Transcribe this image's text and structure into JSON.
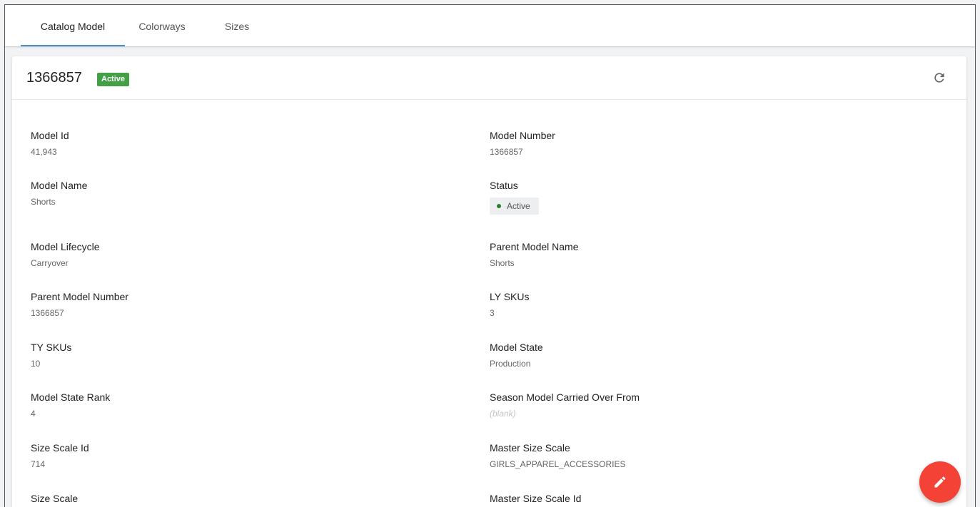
{
  "tabs": [
    {
      "label": "Catalog Model",
      "active": true
    },
    {
      "label": "Colorways",
      "active": false
    },
    {
      "label": "Sizes",
      "active": false
    }
  ],
  "header": {
    "title": "1366857",
    "badge": "Active",
    "refresh_icon": "refresh-icon"
  },
  "fields": {
    "model_id": {
      "label": "Model Id",
      "value": "41,943"
    },
    "model_number": {
      "label": "Model Number",
      "value": "1366857"
    },
    "model_name": {
      "label": "Model Name",
      "value": "Shorts"
    },
    "status": {
      "label": "Status",
      "value": "Active"
    },
    "model_lifecycle": {
      "label": "Model Lifecycle",
      "value": "Carryover"
    },
    "parent_model_name": {
      "label": "Parent Model Name",
      "value": "Shorts"
    },
    "parent_model_number": {
      "label": "Parent Model Number",
      "value": "1366857"
    },
    "ly_skus": {
      "label": "LY SKUs",
      "value": "3"
    },
    "ty_skus": {
      "label": "TY SKUs",
      "value": "10"
    },
    "model_state": {
      "label": "Model State",
      "value": "Production"
    },
    "model_state_rank": {
      "label": "Model State Rank",
      "value": "4"
    },
    "season_carried_from": {
      "label": "Season Model Carried Over From",
      "value": "(blank)"
    },
    "size_scale_id": {
      "label": "Size Scale Id",
      "value": "714"
    },
    "master_size_scale": {
      "label": "Master Size Scale",
      "value": "GIRLS_APPAREL_ACCESSORIES"
    },
    "size_scale": {
      "label": "Size Scale",
      "value": ""
    },
    "master_size_scale_id": {
      "label": "Master Size Scale Id",
      "value": ""
    }
  },
  "fab": {
    "icon": "pencil-icon"
  },
  "colors": {
    "accent": "#4a90c8",
    "active_badge": "#43a047",
    "status_dot": "#2e7d32",
    "fab": "#f44336"
  }
}
